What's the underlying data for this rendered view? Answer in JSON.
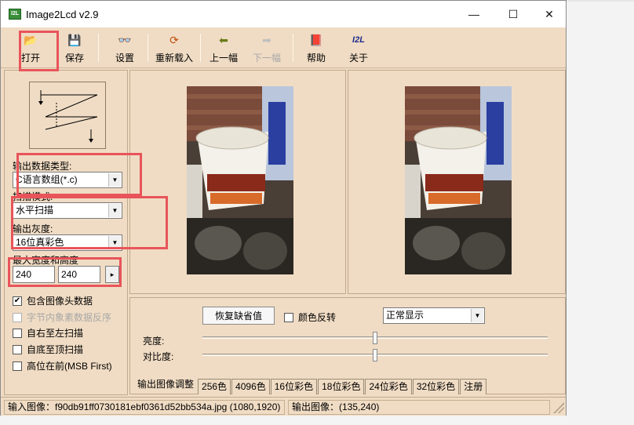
{
  "window": {
    "title": "Image2Lcd v2.9",
    "icon_text": "I2L",
    "controls": {
      "minimize": "—",
      "maximize": "☐",
      "close": "✕"
    }
  },
  "toolbar": {
    "items": [
      {
        "label": "打开",
        "icon": "open-folder-icon",
        "glyph": "📂",
        "enabled": true
      },
      {
        "label": "保存",
        "icon": "save-disk-icon",
        "glyph": "💾",
        "enabled": true
      },
      {
        "label": "设置",
        "icon": "glasses-icon",
        "glyph": "👓",
        "enabled": true
      },
      {
        "label": "重新载入",
        "icon": "reload-icon",
        "glyph": "⟳",
        "enabled": true
      },
      {
        "label": "上一幅",
        "icon": "arrow-left-icon",
        "glyph": "⬅",
        "enabled": true
      },
      {
        "label": "下一幅",
        "icon": "arrow-right-icon",
        "glyph": "➡",
        "enabled": false
      },
      {
        "label": "帮助",
        "icon": "help-book-icon",
        "glyph": "📕",
        "enabled": true
      },
      {
        "label": "关于",
        "icon": "about-logo-icon",
        "glyph": "I2L",
        "enabled": true
      }
    ]
  },
  "settings": {
    "output_type_label": "输出数据类型:",
    "output_type_value": "C语言数组(*.c)",
    "scan_mode_label": "扫描模式:",
    "scan_mode_value": "水平扫描",
    "gray_label": "输出灰度:",
    "gray_value": "16位真彩色",
    "size_label": "最大宽度和高度",
    "width_value": "240",
    "height_value": "240",
    "size_button": "▸",
    "checkboxes": [
      {
        "label": "包含图像头数据",
        "checked": true,
        "enabled": true
      },
      {
        "label": "字节内象素数据反序",
        "checked": false,
        "enabled": false
      },
      {
        "label": "自右至左扫描",
        "checked": false,
        "enabled": true
      },
      {
        "label": "自底至顶扫描",
        "checked": false,
        "enabled": true
      },
      {
        "label": "高位在前(MSB First)",
        "checked": false,
        "enabled": true
      }
    ]
  },
  "adjust": {
    "restore_button": "恢复缺省值",
    "invert_label": "颜色反转",
    "invert_checked": false,
    "display_mode": "正常显示",
    "brightness_label": "亮度:",
    "contrast_label": "对比度:",
    "brightness_level": 0.5,
    "contrast_level": 0.5
  },
  "tabs": [
    "输出图像调整",
    "256色",
    "4096色",
    "16位彩色",
    "18位彩色",
    "24位彩色",
    "32位彩色",
    "注册"
  ],
  "status": {
    "input": "输入图像：f90db91ff0730181ebf0361d52bb534a.jpg (1080,1920)",
    "output": "输出图像：(135,240)"
  },
  "colors": {
    "panel": "#f0dcc4",
    "highlight_box": "#e8545a"
  }
}
